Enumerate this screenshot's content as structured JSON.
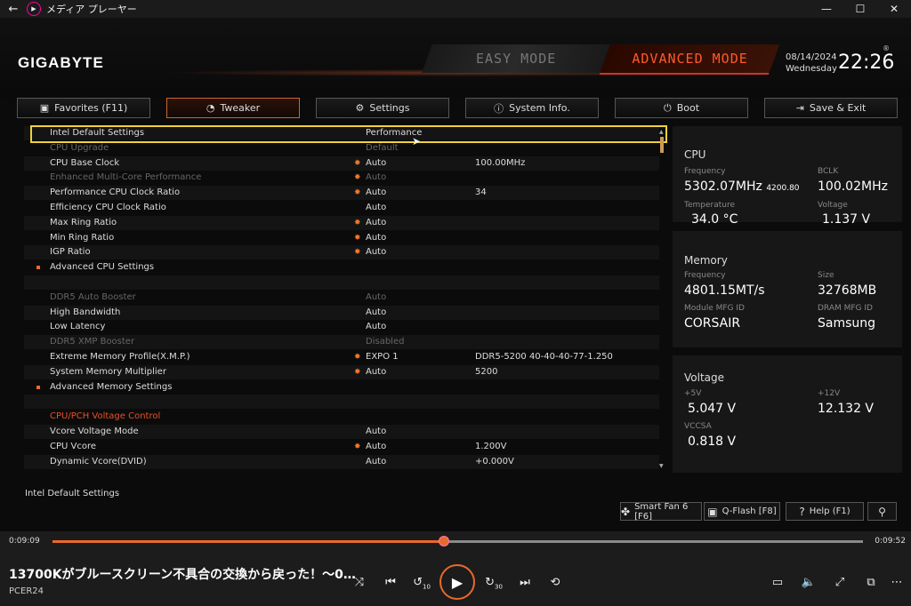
{
  "titlebar": {
    "app_name": "メディア プレーヤー",
    "back": "←",
    "app_icon": "▶",
    "min": "—",
    "max": "☐",
    "close": "✕"
  },
  "header": {
    "logo": "GIGABYTE",
    "easy_mode": "EASY MODE",
    "advanced_mode": "ADVANCED MODE",
    "date": "08/14/2024",
    "day": "Wednesday",
    "time": "22:26",
    "reg": "®"
  },
  "tabs": [
    {
      "label": "Favorites (F11)",
      "icon": "▣"
    },
    {
      "label": "Tweaker",
      "icon": "◔"
    },
    {
      "label": "Settings",
      "icon": "⚙"
    },
    {
      "label": "System Info.",
      "icon": "ⓘ"
    },
    {
      "label": "Boot",
      "icon": "⏻"
    },
    {
      "label": "Save & Exit",
      "icon": "⇥"
    }
  ],
  "settings": [
    {
      "label": "Intel Default Settings",
      "value": "Performance",
      "value2": "",
      "star": false,
      "state": "normal"
    },
    {
      "label": "CPU Upgrade",
      "value": "Default",
      "value2": "",
      "star": false,
      "state": "disabled"
    },
    {
      "label": "CPU Base Clock",
      "value": "Auto",
      "value2": "100.00MHz",
      "star": true,
      "state": "normal"
    },
    {
      "label": "Enhanced Multi-Core Performance",
      "value": "Auto",
      "value2": "",
      "star": true,
      "state": "disabled"
    },
    {
      "label": "Performance CPU Clock Ratio",
      "value": "Auto",
      "value2": "34",
      "star": true,
      "state": "normal"
    },
    {
      "label": "Efficiency CPU Clock Ratio",
      "value": "Auto",
      "value2": "",
      "star": false,
      "state": "normal"
    },
    {
      "label": "Max Ring Ratio",
      "value": "Auto",
      "value2": "",
      "star": true,
      "state": "normal"
    },
    {
      "label": "Min Ring Ratio",
      "value": "Auto",
      "value2": "",
      "star": true,
      "state": "normal"
    },
    {
      "label": "IGP Ratio",
      "value": "Auto",
      "value2": "",
      "star": true,
      "state": "normal"
    },
    {
      "label": "Advanced CPU Settings",
      "value": "",
      "value2": "",
      "star": false,
      "state": "submenu"
    },
    {
      "label": "",
      "value": "",
      "value2": "",
      "star": false,
      "state": "blank"
    },
    {
      "label": "DDR5 Auto Booster",
      "value": "Auto",
      "value2": "",
      "star": false,
      "state": "disabled"
    },
    {
      "label": "High Bandwidth",
      "value": "Auto",
      "value2": "",
      "star": false,
      "state": "normal"
    },
    {
      "label": "Low Latency",
      "value": "Auto",
      "value2": "",
      "star": false,
      "state": "normal"
    },
    {
      "label": "DDR5 XMP Booster",
      "value": "Disabled",
      "value2": "",
      "star": false,
      "state": "disabled"
    },
    {
      "label": "Extreme Memory Profile(X.M.P.)",
      "value": "EXPO 1",
      "value2": "DDR5-5200 40-40-40-77-1.250",
      "star": true,
      "state": "normal"
    },
    {
      "label": "System Memory Multiplier",
      "value": "Auto",
      "value2": "5200",
      "star": true,
      "state": "normal"
    },
    {
      "label": "Advanced Memory Settings",
      "value": "",
      "value2": "",
      "star": false,
      "state": "submenu"
    },
    {
      "label": "",
      "value": "",
      "value2": "",
      "star": false,
      "state": "blank"
    },
    {
      "label": "CPU/PCH Voltage Control",
      "value": "",
      "value2": "",
      "star": false,
      "state": "section"
    },
    {
      "label": "Vcore Voltage Mode",
      "value": "Auto",
      "value2": "",
      "star": false,
      "state": "normal"
    },
    {
      "label": "CPU Vcore",
      "value": "Auto",
      "value2": "1.200V",
      "star": true,
      "state": "normal"
    },
    {
      "label": "Dynamic Vcore(DVID)",
      "value": "Auto",
      "value2": "+0.000V",
      "star": false,
      "state": "normal"
    }
  ],
  "star_glyph": "✸",
  "scroll_up": "▲",
  "scroll_down": "▼",
  "cursor_glyph": "➤",
  "help_text": "Intel Default Settings",
  "cpu": {
    "title": "CPU",
    "freq_label": "Frequency",
    "freq": "5302.07MHz",
    "freq_sub": "4200.80",
    "bclk_label": "BCLK",
    "bclk": "100.02MHz",
    "temp_label": "Temperature",
    "temp": "34.0 °C",
    "volt_label": "Voltage",
    "volt": "1.137 V"
  },
  "memory": {
    "title": "Memory",
    "freq_label": "Frequency",
    "freq": "4801.15MT/s",
    "size_label": "Size",
    "size": "32768MB",
    "mfg_label": "Module MFG ID",
    "mfg": "CORSAIR",
    "dram_label": "DRAM MFG ID",
    "dram": "Samsung"
  },
  "voltage": {
    "title": "Voltage",
    "v5_label": "+5V",
    "v5": "5.047 V",
    "v12_label": "+12V",
    "v12": "12.132 V",
    "vccsa_label": "VCCSA",
    "vccsa": "0.818 V"
  },
  "bottom_buttons": [
    {
      "label": "Smart Fan 6 [F6]",
      "icon": "✤"
    },
    {
      "label": "Q-Flash [F8]",
      "icon": "▣"
    },
    {
      "label": "Help (F1)",
      "icon": "?"
    },
    {
      "label": "",
      "icon": "⚲"
    }
  ],
  "player": {
    "current_time": "0:09:09",
    "duration": "0:09:52",
    "progress": 0.483,
    "title": "13700Kがブルースクリーン不具合の交換から戻った！〜0…",
    "channel": "PCER24",
    "controls": {
      "shuffle": "⤨",
      "prev": "⏮",
      "back10": "↺",
      "play": "▶",
      "fwd30": "↻",
      "next": "⏭",
      "repeat": "⟲",
      "captions": "▭",
      "volume": "🔈",
      "expand": "⤢",
      "miniplayer": "⧉",
      "more": "⋯"
    },
    "back10_num": "10",
    "fwd30_num": "30"
  }
}
